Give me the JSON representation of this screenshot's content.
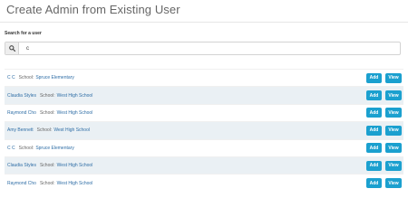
{
  "page": {
    "title": "Create Admin from Existing User"
  },
  "search": {
    "label": "Search for a user",
    "value": "c",
    "icon": "search-icon"
  },
  "colors": {
    "accent": "#1ba0cf",
    "link": "#2f6ea6",
    "row_alt": "#eaf0f4"
  },
  "users": [
    {
      "name": "C C",
      "school_label": "School:",
      "school": "Spruce Elementary",
      "add_label": "Add",
      "view_label": "View"
    },
    {
      "name": "Claudia Styles",
      "school_label": "School:",
      "school": "West High School",
      "add_label": "Add",
      "view_label": "View"
    },
    {
      "name": "Raymond Cho",
      "school_label": "School:",
      "school": "West High School",
      "add_label": "Add",
      "view_label": "View"
    },
    {
      "name": "Amy Bennett",
      "school_label": "School:",
      "school": "West High School",
      "add_label": "Add",
      "view_label": "View"
    },
    {
      "name": "C C",
      "school_label": "School:",
      "school": "Spruce Elementary",
      "add_label": "Add",
      "view_label": "View"
    },
    {
      "name": "Claudia Styles",
      "school_label": "School:",
      "school": "West High School",
      "add_label": "Add",
      "view_label": "View"
    },
    {
      "name": "Raymond Cho",
      "school_label": "School:",
      "school": "West High School",
      "add_label": "Add",
      "view_label": "View"
    }
  ]
}
